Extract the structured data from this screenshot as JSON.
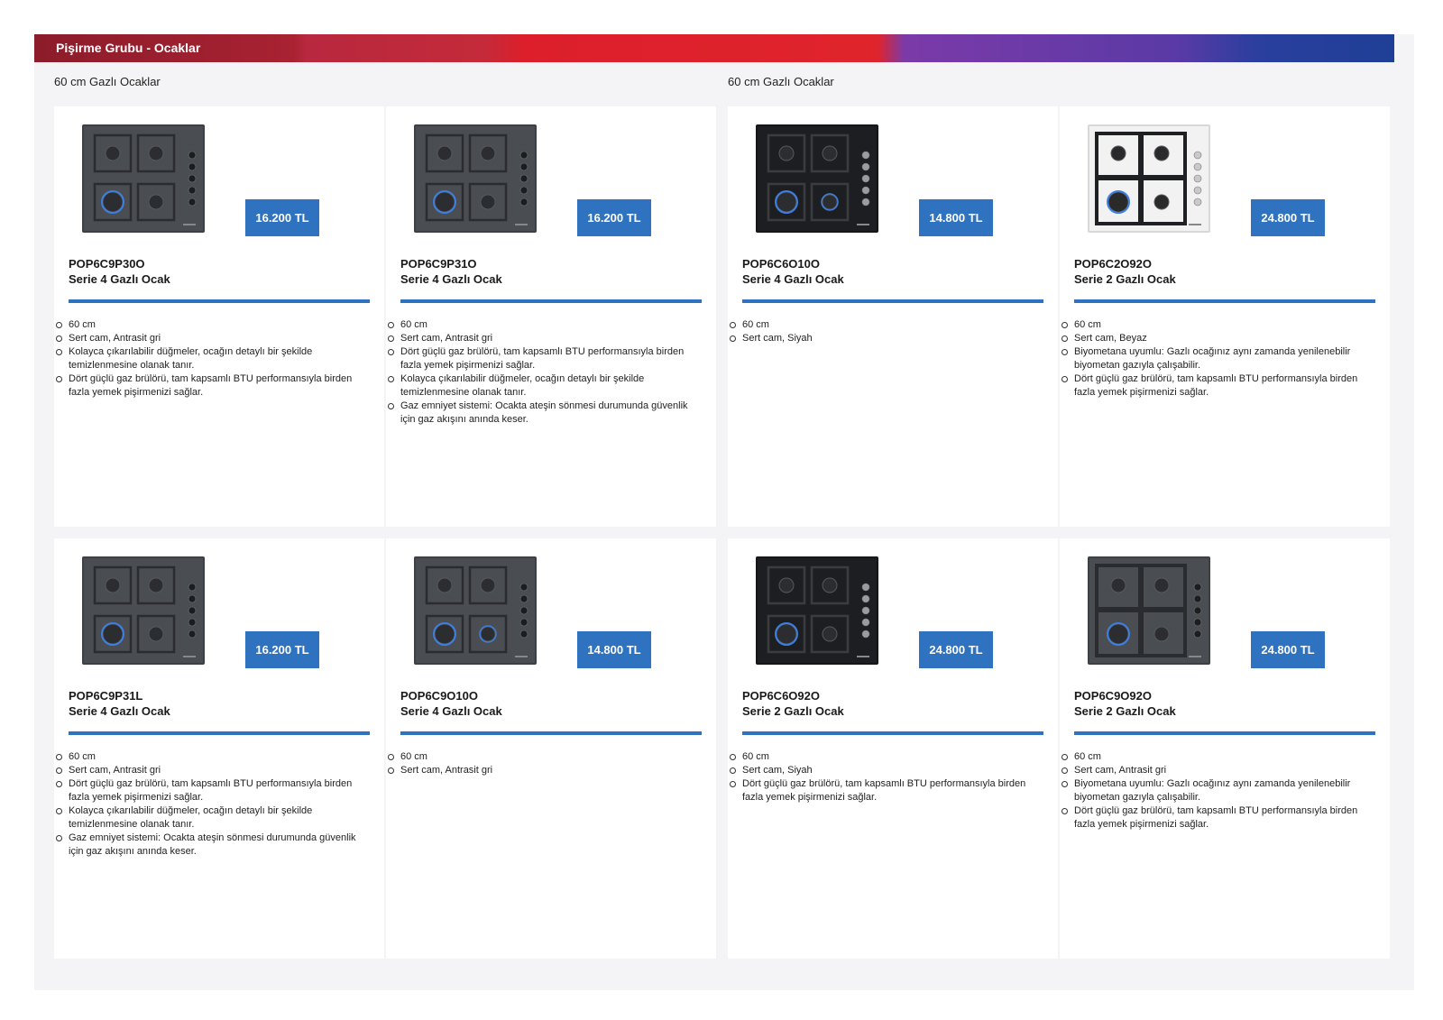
{
  "header": {
    "title": "Pişirme Grubu - Ocaklar"
  },
  "sections": {
    "left_title": "60 cm Gazlı Ocaklar",
    "right_title": "60 cm Gazlı Ocaklar"
  },
  "colors": {
    "price_badge": "#2f72bf",
    "rule": "#2f72bf"
  },
  "products": [
    {
      "model": "POP6C9P30O",
      "name": "Serie 4 Gazlı Ocak",
      "price": "16.200 TL",
      "image": "anthracite-hob-knobs-right",
      "features": [
        "60 cm",
        "Sert cam, Antrasit gri",
        "Kolayca çıkarılabilir düğmeler, ocağın detaylı bir şekilde temizlenmesine olanak tanır.",
        "Dört güçlü gaz brülörü, tam kapsamlı BTU performansıyla birden fazla yemek pişirmenizi sağlar."
      ]
    },
    {
      "model": "POP6C9P31O",
      "name": "Serie 4 Gazlı Ocak",
      "price": "16.200 TL",
      "image": "anthracite-hob-knobs-right",
      "features": [
        "60 cm",
        "Sert cam, Antrasit gri",
        "Dört güçlü gaz brülörü, tam kapsamlı BTU performansıyla birden fazla yemek pişirmenizi sağlar.",
        "Kolayca çıkarılabilir düğmeler, ocağın detaylı bir şekilde temizlenmesine olanak tanır.",
        "Gaz emniyet sistemi: Ocakta ateşin sönmesi durumunda güvenlik için gaz akışını anında keser."
      ]
    },
    {
      "model": "POP6C6O10O",
      "name": "Serie 4 Gazlı Ocak",
      "price": "14.800 TL",
      "image": "black-hob-round-burners",
      "features": [
        "60 cm",
        "Sert cam, Siyah"
      ]
    },
    {
      "model": "POP6C2O92O",
      "name": "Serie 2 Gazlı Ocak",
      "price": "24.800 TL",
      "image": "white-hob-continuous-grates",
      "features": [
        "60 cm",
        "Sert cam, Beyaz",
        "Biyometana uyumlu: Gazlı ocağınız aynı zamanda yenilenebilir biyometan gazıyla çalışabilir.",
        "Dört güçlü gaz brülörü, tam kapsamlı BTU performansıyla birden fazla yemek pişirmenizi sağlar."
      ]
    },
    {
      "model": "POP6C9P31L",
      "name": "Serie 4 Gazlı Ocak",
      "price": "16.200 TL",
      "image": "anthracite-hob-knobs-right",
      "features": [
        "60 cm",
        "Sert cam, Antrasit gri",
        "Dört güçlü gaz brülörü, tam kapsamlı BTU performansıyla birden fazla yemek pişirmenizi sağlar.",
        "Kolayca çıkarılabilir düğmeler, ocağın detaylı bir şekilde temizlenmesine olanak tanır.",
        "Gaz emniyet sistemi: Ocakta ateşin sönmesi durumunda güvenlik için gaz akışını anında keser."
      ]
    },
    {
      "model": "POP6C9O10O",
      "name": "Serie 4 Gazlı Ocak",
      "price": "14.800 TL",
      "image": "anthracite-hob-round-burners",
      "features": [
        "60 cm",
        "Sert cam, Antrasit gri"
      ]
    },
    {
      "model": "POP6C6O92O",
      "name": "Serie 2 Gazlı Ocak",
      "price": "24.800 TL",
      "image": "black-hob-grates",
      "features": [
        "60 cm",
        "Sert cam, Siyah",
        "Dört güçlü gaz brülörü, tam kapsamlı BTU performansıyla birden fazla yemek pişirmenizi sağlar."
      ]
    },
    {
      "model": "POP6C9O92O",
      "name": "Serie 2 Gazlı Ocak",
      "price": "24.800 TL",
      "image": "anthracite-hob-continuous-grates",
      "features": [
        "60 cm",
        "Sert cam, Antrasit gri",
        "Biyometana uyumlu: Gazlı ocağınız aynı zamanda yenilenebilir biyometan gazıyla çalışabilir.",
        "Dört güçlü gaz brülörü, tam kapsamlı BTU performansıyla birden fazla yemek pişirmenizi sağlar."
      ]
    }
  ]
}
